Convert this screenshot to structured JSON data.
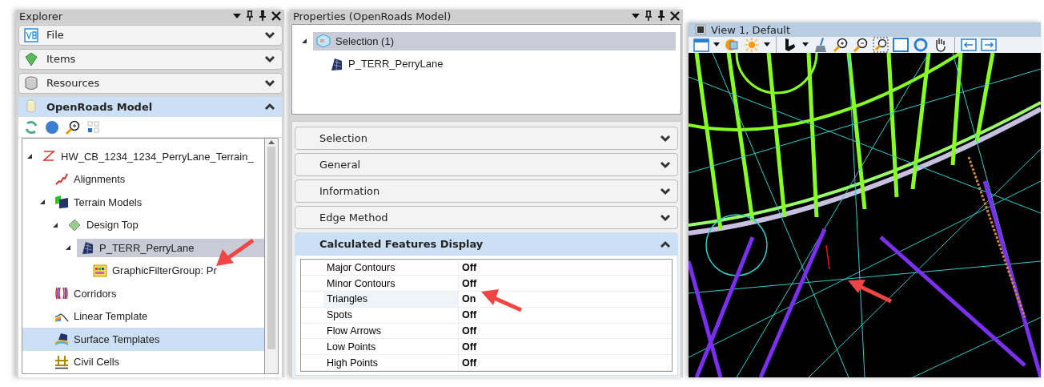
{
  "explorer": {
    "title": "Explorer",
    "sections": [
      {
        "label": "File",
        "expanded": false
      },
      {
        "label": "Items",
        "expanded": false
      },
      {
        "label": "Resources",
        "expanded": false
      },
      {
        "label": "OpenRoads Model",
        "expanded": true
      }
    ],
    "tree": [
      {
        "label": "HW_CB_1234_1234_PerryLane_Terrain_",
        "kind": "z",
        "expanded": true,
        "selected": false,
        "hovered": false,
        "children": [
          {
            "label": "Alignments",
            "kind": "align",
            "selected": false,
            "hovered": false
          },
          {
            "label": "Terrain Models",
            "kind": "terrain",
            "expanded": true,
            "selected": false,
            "hovered": false,
            "children": [
              {
                "label": "Design Top",
                "kind": "diamond",
                "expanded": true,
                "selected": false,
                "hovered": false,
                "children": [
                  {
                    "label": "P_TERR_PerryLane",
                    "kind": "mesh",
                    "expanded": true,
                    "selected": true,
                    "hovered": false,
                    "children": [
                      {
                        "label": "GraphicFilterGroup: Pr",
                        "kind": "filter",
                        "selected": false,
                        "hovered": false
                      }
                    ]
                  }
                ]
              }
            ]
          },
          {
            "label": "Corridors",
            "kind": "corridor",
            "selected": false,
            "hovered": false
          },
          {
            "label": "Linear Template",
            "kind": "linear",
            "selected": false,
            "hovered": false
          },
          {
            "label": "Surface Templates",
            "kind": "surface",
            "selected": false,
            "hovered": true
          },
          {
            "label": "Civil Cells",
            "kind": "cell",
            "selected": false,
            "hovered": false
          }
        ]
      }
    ]
  },
  "properties": {
    "title": "Properties (OpenRoads Model)",
    "tree": [
      {
        "label": "Selection (1)",
        "kind": "cube",
        "expanded": true,
        "selected": true,
        "hovered": false,
        "children": [
          {
            "label": "P_TERR_PerryLane",
            "kind": "mesh",
            "selected": false,
            "hovered": false
          }
        ]
      }
    ],
    "sections": [
      {
        "label": "Selection",
        "expanded": false
      },
      {
        "label": "General",
        "expanded": false
      },
      {
        "label": "Information",
        "expanded": false
      },
      {
        "label": "Edge Method",
        "expanded": false
      },
      {
        "label": "Calculated Features Display",
        "expanded": true,
        "rows": [
          {
            "name": "Major Contours",
            "value": "Off",
            "highlighted": false
          },
          {
            "name": "Minor Contours",
            "value": "Off",
            "highlighted": false
          },
          {
            "name": "Triangles",
            "value": "On",
            "highlighted": true
          },
          {
            "name": "Spots",
            "value": "Off",
            "highlighted": false
          },
          {
            "name": "Flow Arrows",
            "value": "Off",
            "highlighted": false
          },
          {
            "name": "Low Points",
            "value": "Off",
            "highlighted": false
          },
          {
            "name": "High Points",
            "value": "Off",
            "highlighted": false
          }
        ]
      }
    ]
  },
  "view": {
    "title": "View 1, Default"
  }
}
